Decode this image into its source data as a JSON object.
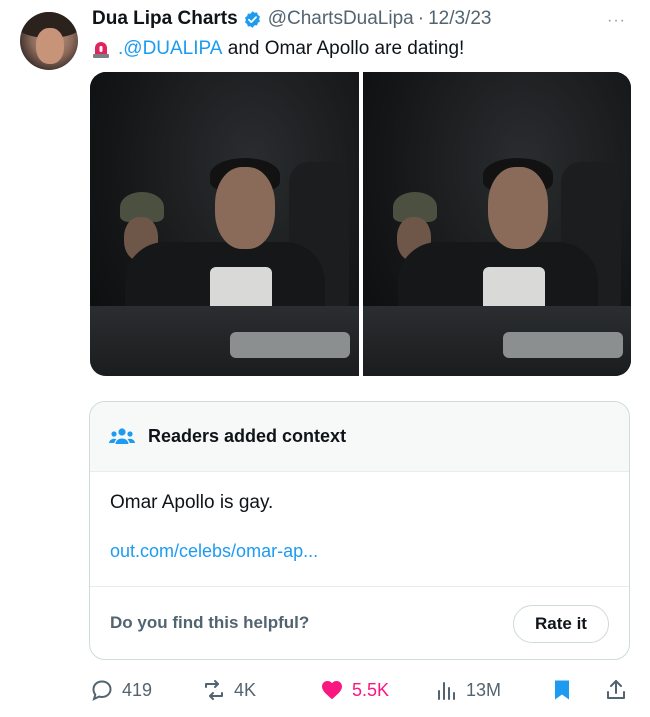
{
  "tweet": {
    "display_name": "Dua Lipa Charts",
    "handle": "@ChartsDuaLipa",
    "separator": "·",
    "date": "12/3/23",
    "more": "···",
    "mention": ".@DUALIPA",
    "text_rest": " and Omar Apollo are dating!"
  },
  "note": {
    "title": "Readers added context",
    "body": "Omar Apollo is gay.",
    "link": "out.com/celebs/omar-ap...",
    "question": "Do you find this helpful?",
    "rate_label": "Rate it"
  },
  "actions": {
    "replies": "419",
    "reposts": "4K",
    "likes": "5.5K",
    "views": "13M"
  },
  "colors": {
    "accent": "#1d9bf0",
    "like": "#f91880",
    "muted": "#536471"
  },
  "icons": [
    "verified-badge-icon",
    "siren-icon",
    "people-icon",
    "reply-icon",
    "repost-icon",
    "like-icon",
    "views-icon",
    "bookmark-icon",
    "share-icon"
  ]
}
